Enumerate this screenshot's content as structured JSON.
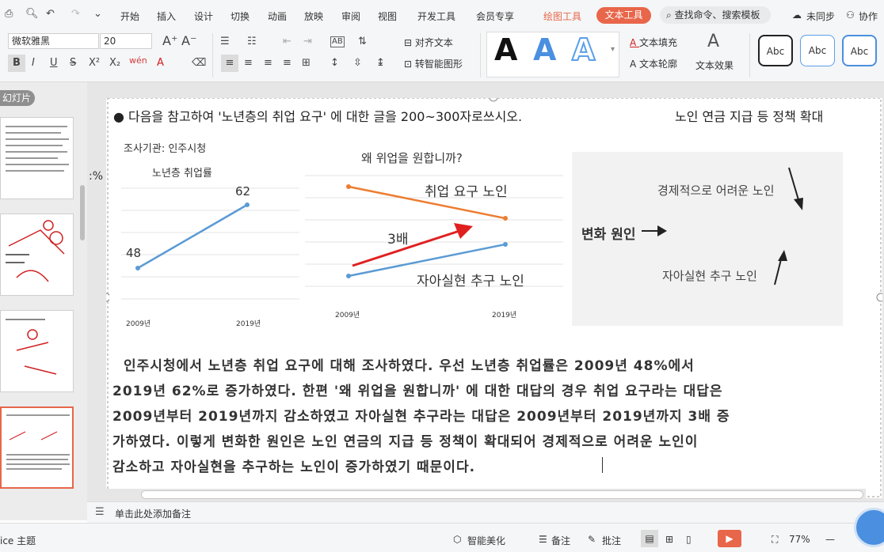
{
  "menu": {
    "tabs": [
      "开始",
      "插入",
      "设计",
      "切换",
      "动画",
      "放映",
      "审阅",
      "视图",
      "开发工具",
      "会员专享"
    ],
    "draw_tools": "绘图工具",
    "text_tools": "文本工具",
    "search": "查找命令、搜索模板",
    "sync": "未同步",
    "collab": "协作"
  },
  "toolbar": {
    "font": "微软雅黑",
    "size": "20",
    "align_text": "对齐文本",
    "smart_shape": "转智能图形",
    "text_fill": "文本填充",
    "text_outline": "文本轮廓",
    "text_effect": "文本效果",
    "abc": [
      "Abc",
      "Abc",
      "Abc"
    ],
    "big_a": [
      "A",
      "A",
      "A"
    ],
    "brand_color": "#e8664a"
  },
  "sidebar": {
    "label": "幻灯片"
  },
  "slide": {
    "heading": "● 다음을 참고하여 '노년층의 취업 요구' 에 대한 글을 200~300자로쓰시오.",
    "heading_right": "노인 연금 지급 등 정책 확대",
    "source": "조사기관: 인주시청",
    "left_pct": ":%",
    "chart1": {
      "title": "노년층 취업률",
      "labels": [
        "48",
        "62"
      ],
      "x": [
        "2009년",
        "2019년"
      ]
    },
    "chart2": {
      "title": "왜 위업을 원합니까?",
      "series1": "취업 요구 노인",
      "series2": "자아실현 추구 노인",
      "annot": "3배",
      "x": [
        "2009년",
        "2019년"
      ]
    },
    "diagram": {
      "top": "경제적으로 어려운 노인",
      "mid": "변화 원인",
      "bottom": "자아실현 추구 노인"
    },
    "para": [
      "인주시청에서 노년층 취업 요구에 대해 조사하였다. 우선 노년층 취업률은 2009년 48%에서",
      "2019년 62%로 증가하였다. 한편 '왜 위업을 원합니까' 에 대한 대답의 경우 취업 요구라는 대답은",
      "2009년부터 2019년까지 감소하였고 자아실현 추구라는 대답은 2009년부터 2019년까지 3배 증",
      "가하였다. 이렇게 변화한 원인은 노인 연금의 지급 등 정책이 확대되어 경제적으로 어려운 노인이",
      "감소하고 자아실현을 추구하는 노인이 증가하였기 때문이다."
    ]
  },
  "notes": "单击此处添加备注",
  "status": {
    "theme": "ice 主题",
    "beautify": "智能美化",
    "remark": "备注",
    "comment": "批注",
    "zoom": "77%"
  }
}
